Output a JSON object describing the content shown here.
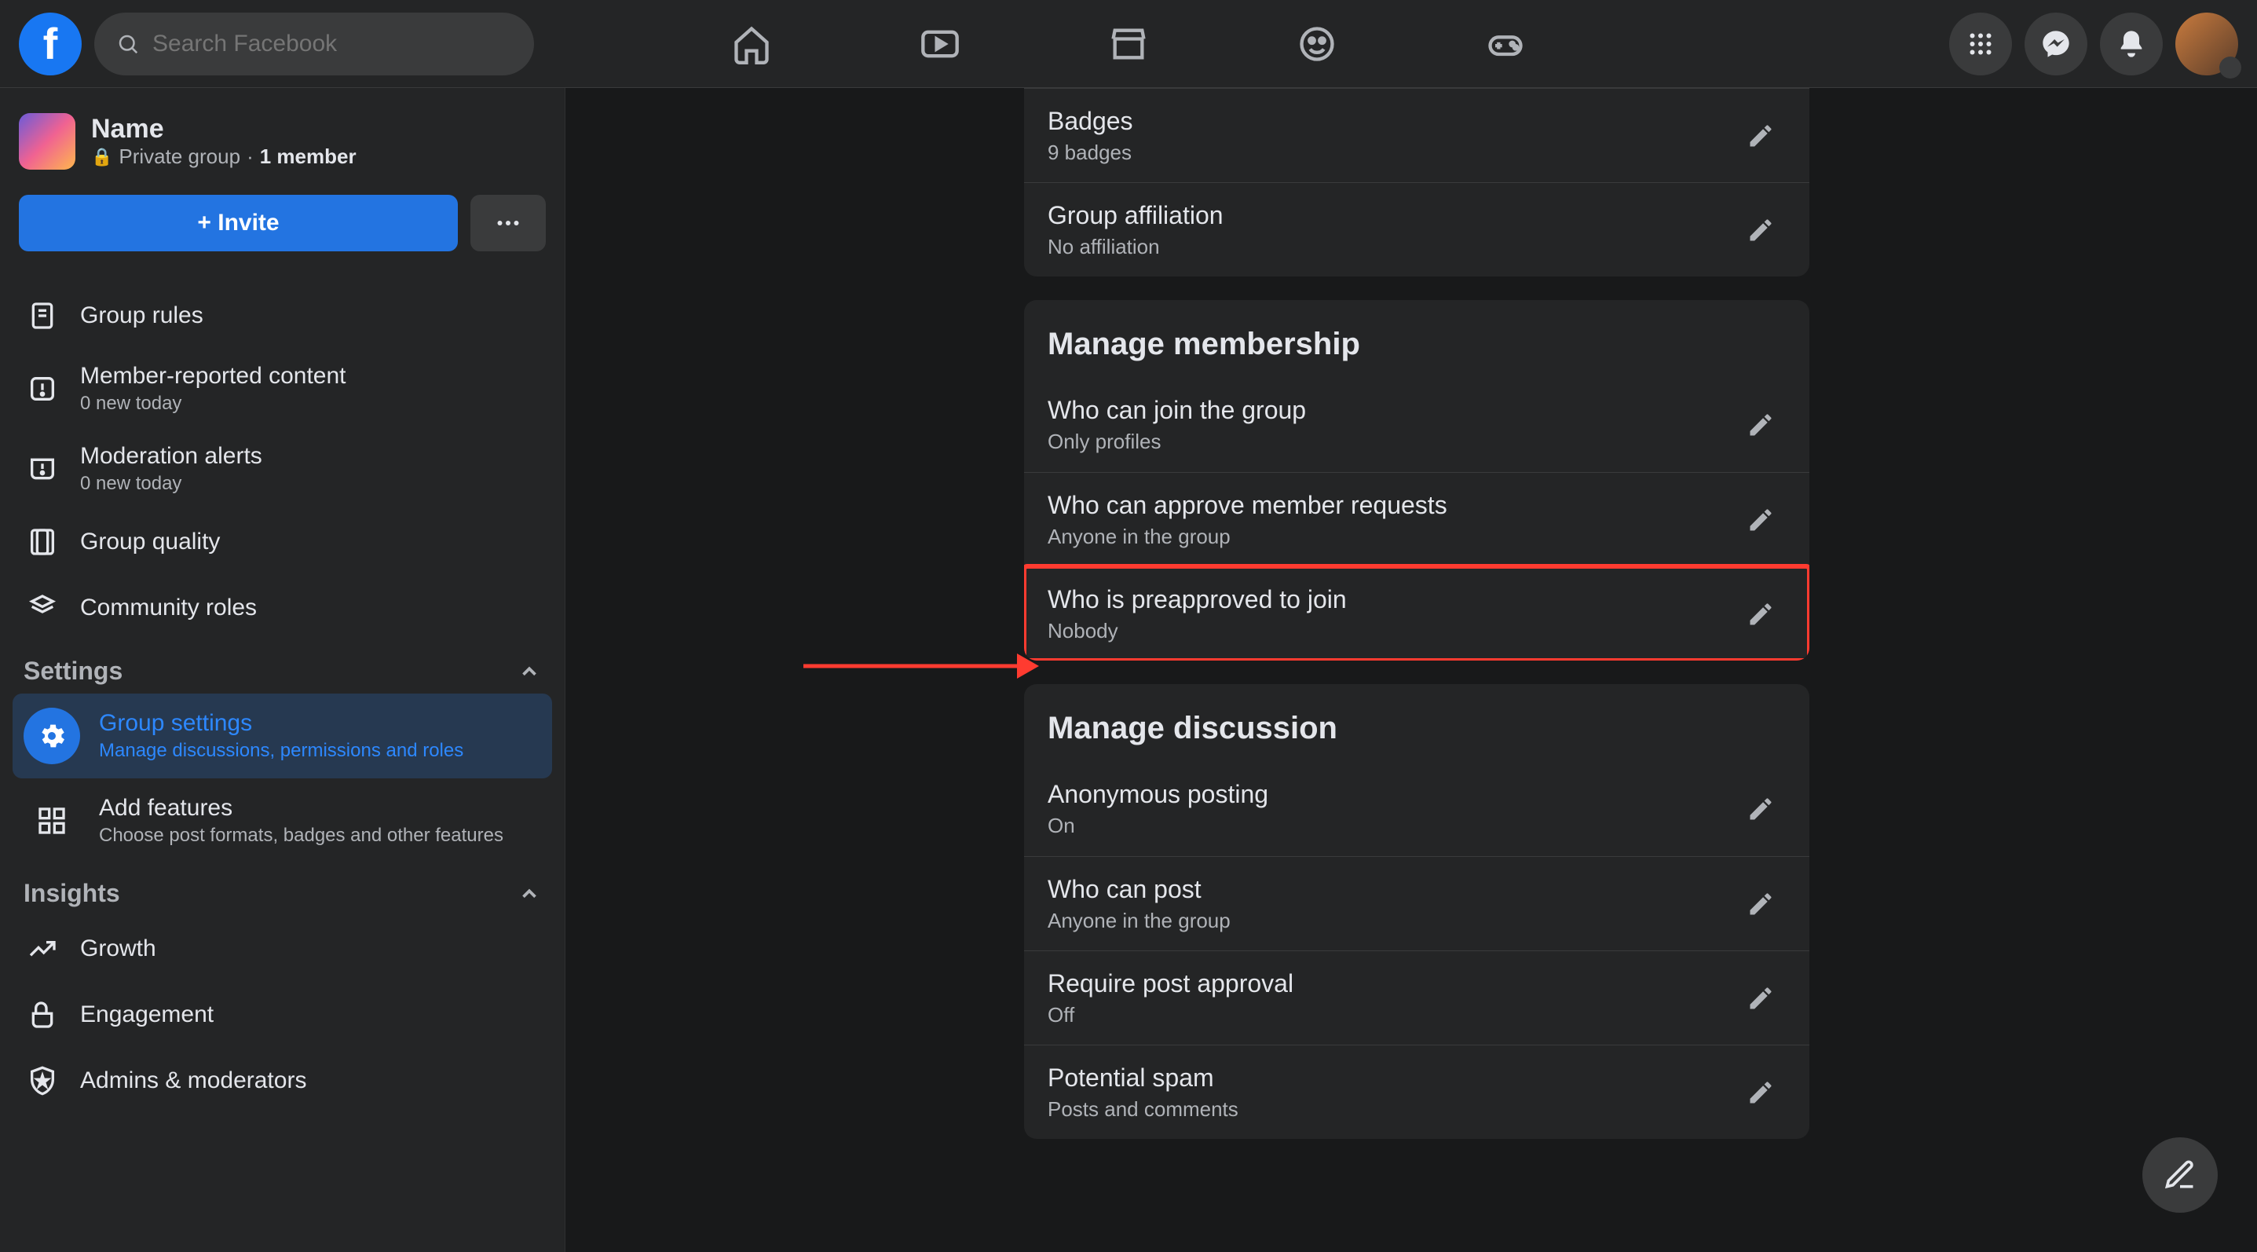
{
  "search": {
    "placeholder": "Search Facebook"
  },
  "group": {
    "name": "Name",
    "privacy": "Private group",
    "members": "1 member",
    "invite_label": "+ Invite"
  },
  "sidebar": {
    "items": [
      {
        "label": "Group rules"
      },
      {
        "label": "Member-reported content",
        "sub": "0 new today"
      },
      {
        "label": "Moderation alerts",
        "sub": "0 new today"
      },
      {
        "label": "Group quality"
      },
      {
        "label": "Community roles"
      }
    ],
    "sections": {
      "settings": "Settings",
      "insights": "Insights"
    },
    "settings_items": [
      {
        "label": "Group settings",
        "sub": "Manage discussions, permissions and roles"
      },
      {
        "label": "Add features",
        "sub": "Choose post formats, badges and other features"
      }
    ],
    "insights_items": [
      {
        "label": "Growth"
      },
      {
        "label": "Engagement"
      },
      {
        "label": "Admins & moderators"
      }
    ]
  },
  "cards": {
    "top": [
      {
        "title": "Badges",
        "value": "9 badges"
      },
      {
        "title": "Group affiliation",
        "value": "No affiliation"
      }
    ],
    "membership": {
      "heading": "Manage membership",
      "rows": [
        {
          "title": "Who can join the group",
          "value": "Only profiles"
        },
        {
          "title": "Who can approve member requests",
          "value": "Anyone in the group"
        },
        {
          "title": "Who is preapproved to join",
          "value": "Nobody",
          "highlighted": true
        }
      ]
    },
    "discussion": {
      "heading": "Manage discussion",
      "rows": [
        {
          "title": "Anonymous posting",
          "value": "On"
        },
        {
          "title": "Who can post",
          "value": "Anyone in the group"
        },
        {
          "title": "Require post approval",
          "value": "Off"
        },
        {
          "title": "Potential spam",
          "value": "Posts and comments"
        }
      ]
    }
  }
}
